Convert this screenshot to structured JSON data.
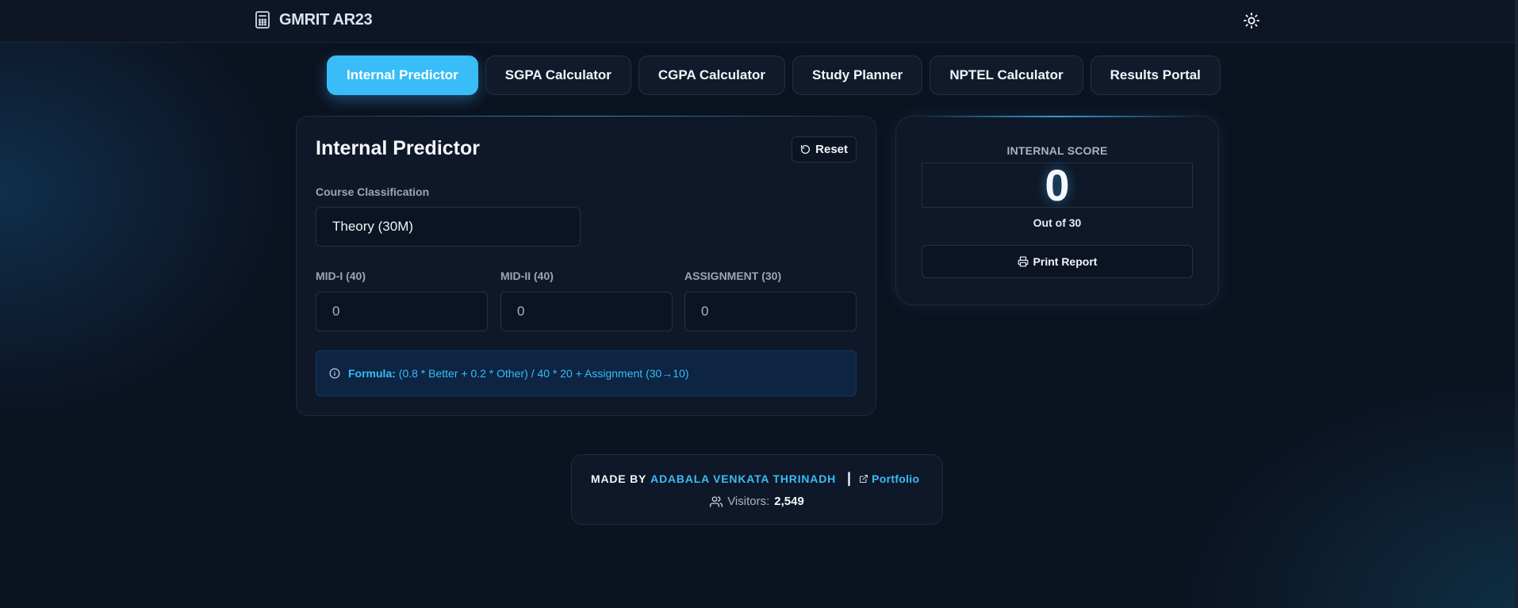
{
  "header": {
    "brand_icon": "calculator-icon",
    "brand_title": "GMRIT AR23",
    "theme_toggle_icon": "sun-icon"
  },
  "tabs": [
    {
      "label": "Internal Predictor",
      "active": true
    },
    {
      "label": "SGPA Calculator",
      "active": false
    },
    {
      "label": "CGPA Calculator",
      "active": false
    },
    {
      "label": "Study Planner",
      "active": false
    },
    {
      "label": "NPTEL Calculator",
      "active": false
    },
    {
      "label": "Results Portal",
      "active": false
    }
  ],
  "predictor": {
    "title": "Internal Predictor",
    "reset_label": "Reset",
    "reset_icon": "rotate-ccw-icon",
    "course_label": "Course Classification",
    "course_value": "Theory (30M)",
    "mid1_label": "MID-I (40)",
    "mid1_value": "0",
    "mid2_label": "MID-II (40)",
    "mid2_value": "0",
    "assignment_label": "ASSIGNMENT (30)",
    "assignment_value": "0",
    "formula_icon": "info-icon",
    "formula_label": "Formula:",
    "formula_text": "(0.8 * Better + 0.2 * Other) / 40 * 20 + Assignment (30→10)"
  },
  "score": {
    "label": "INTERNAL SCORE",
    "value": "0",
    "out_of": "Out of 30",
    "print_label": "Print Report",
    "print_icon": "printer-icon"
  },
  "footer": {
    "made_by": "MADE BY",
    "author": "ADABALA VENKATA THRINADH",
    "separator": "|",
    "portfolio_label": "Portfolio",
    "portfolio_icon": "external-link-icon",
    "visitors_icon": "users-icon",
    "visitors_label": "Visitors:",
    "visitors_count": "2,549"
  },
  "colors": {
    "background": "#0b1220",
    "card": "#0f1828",
    "accent": "#38bdf8",
    "formula_bg": "#0d2442"
  }
}
